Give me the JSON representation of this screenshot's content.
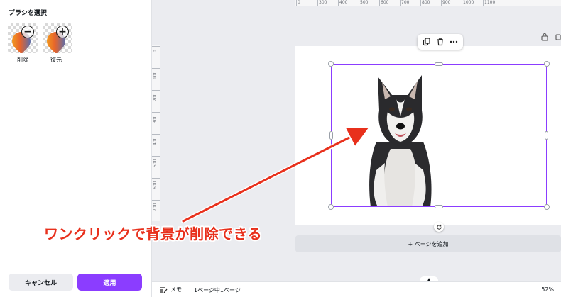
{
  "panel": {
    "title": "ブラシを選択",
    "brushes": [
      {
        "label": "削除",
        "icon": "eraser-minus-icon"
      },
      {
        "label": "復元",
        "icon": "restore-plus-icon"
      }
    ],
    "cancel_label": "キャンセル",
    "apply_label": "適用"
  },
  "ruler": {
    "top_ticks": [
      "0",
      "300",
      "400",
      "500",
      "600",
      "700",
      "800",
      "900",
      "1000",
      "1100"
    ],
    "left_ticks": [
      "0",
      "100",
      "200",
      "300",
      "400",
      "500",
      "600",
      "700"
    ]
  },
  "canvas": {
    "add_page_label": "+ ページを追加",
    "image_subject": "husky-dog"
  },
  "annotation": {
    "text": "ワンクリックで背景が削除できる"
  },
  "footer": {
    "memo_label": "メモ",
    "page_count": "1ページ中1ページ",
    "zoom": "52%"
  },
  "colors": {
    "accent": "#8b3dff",
    "annotation_red": "#e8301c"
  }
}
